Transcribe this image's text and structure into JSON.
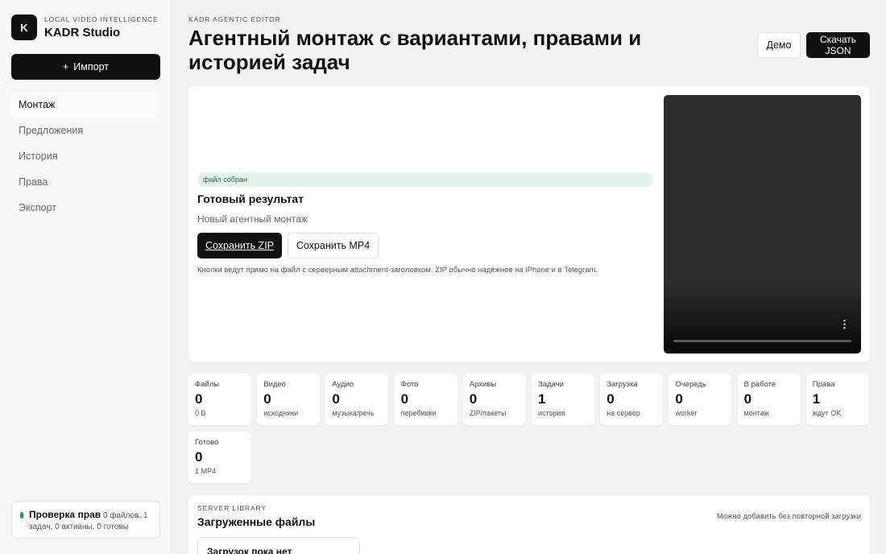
{
  "sidebar": {
    "logo_letter": "K",
    "eyebrow": "LOCAL VIDEO INTELLIGENCE",
    "app_name": "KADR Studio",
    "import_icon": "+",
    "import_label": "Импорт",
    "nav": [
      {
        "label": "Монтаж",
        "active": true
      },
      {
        "label": "Предложения"
      },
      {
        "label": "История"
      },
      {
        "label": "Права"
      },
      {
        "label": "Экспорт"
      }
    ],
    "status": {
      "title": "Проверка прав",
      "detail": "0 файлов, 1 задач, 0 активны, 0 готовы",
      "dot_color": "#2e9d5b"
    }
  },
  "header": {
    "eyebrow": "KADR AGENTIC EDITOR",
    "title": "Агентный монтаж с вариантами, правами и историей задач",
    "demo_label": "Демо",
    "download_json_label": "Скачать JSON"
  },
  "result": {
    "badge": "файл собран",
    "title": "Готовый результат",
    "subtitle": "Новый агентный монтаж",
    "save_zip_label": "Сохранить ZIP",
    "save_mp4_label": "Сохранить MP4",
    "hint": "Кнопки ведут прямо на файл с серверным attachment-заголовком. ZIP обычно надёжнее на iPhone и в Telegram.",
    "video_menu_icon": "more-vertical-icon"
  },
  "stats": [
    {
      "label": "Файлы",
      "value": "0",
      "sub": "0 B"
    },
    {
      "label": "Видео",
      "value": "0",
      "sub": "исходники"
    },
    {
      "label": "Аудио",
      "value": "0",
      "sub": "музыка/речь"
    },
    {
      "label": "Фото",
      "value": "0",
      "sub": "перебивки"
    },
    {
      "label": "Архивы",
      "value": "0",
      "sub": "ZIP/пакеты"
    },
    {
      "label": "Задачи",
      "value": "1",
      "sub": "история"
    },
    {
      "label": "Загрузка",
      "value": "0",
      "sub": "на сервер"
    },
    {
      "label": "Очередь",
      "value": "0",
      "sub": "worker"
    },
    {
      "label": "В работе",
      "value": "0",
      "sub": "монтаж"
    },
    {
      "label": "Права",
      "value": "1",
      "sub": "ждут OK"
    },
    {
      "label": "Готово",
      "value": "0",
      "sub": "1 MP4"
    }
  ],
  "library": {
    "eyebrow": "SERVER LIBRARY",
    "title": "Загруженные файлы",
    "note": "Можно добавить без повторной загрузки",
    "empty_title": "Загрузок пока нет"
  }
}
